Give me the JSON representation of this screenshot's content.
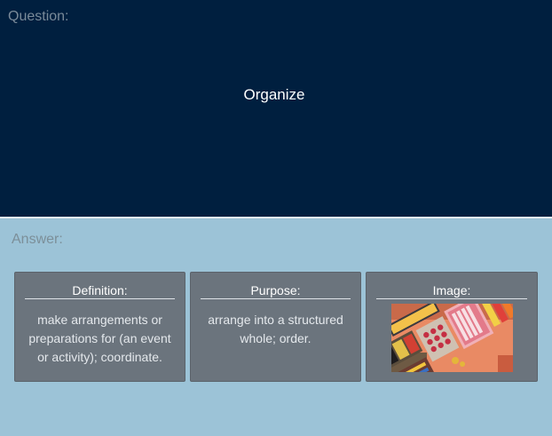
{
  "question": {
    "heading": "Question:",
    "text": "Organize"
  },
  "answer": {
    "heading": "Answer:",
    "cards": [
      {
        "title": "Definition:",
        "text": "make arrangements or preparations for (an event or activity); coordinate."
      },
      {
        "title": "Purpose:",
        "text": "arrange into a structured whole; order."
      },
      {
        "title": "Image:"
      }
    ]
  },
  "colors": {
    "question_bg": "#001f3f",
    "answer_bg": "#9cc3d7",
    "card_bg": "#6b747d"
  }
}
